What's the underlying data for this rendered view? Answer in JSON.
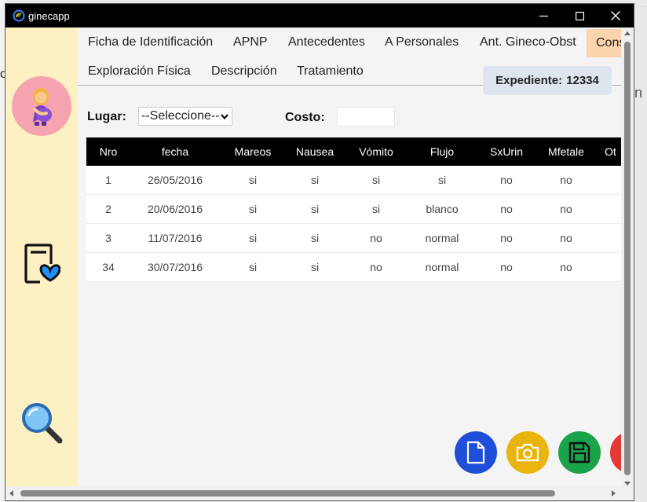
{
  "window": {
    "title": "ginecapp"
  },
  "tabs": {
    "row1": [
      "Ficha de Identificación",
      "APNP",
      "Antecedentes",
      "A Personales",
      "Ant. Gineco-Obst",
      "Cons"
    ],
    "row2": [
      "Exploración Física",
      "Descripción",
      "Tratamiento"
    ],
    "active": "Cons"
  },
  "expediente": {
    "label": "Expediente:",
    "value": "12334"
  },
  "form": {
    "lugar_label": "Lugar:",
    "lugar_selected": "--Seleccione--",
    "costo_label": "Costo:",
    "costo_value": ""
  },
  "table": {
    "columns": [
      "Nro",
      "fecha",
      "Mareos",
      "Nausea",
      "Vómito",
      "Flujo",
      "SxUrin",
      "Mfetale",
      "Ot"
    ],
    "rows": [
      [
        "1",
        "26/05/2016",
        "si",
        "si",
        "si",
        "si",
        "no",
        "no"
      ],
      [
        "2",
        "20/06/2016",
        "si",
        "si",
        "si",
        "blanco",
        "no",
        "no"
      ],
      [
        "3",
        "11/07/2016",
        "si",
        "si",
        "no",
        "normal",
        "no",
        "no"
      ],
      [
        "34",
        "30/07/2016",
        "si",
        "si",
        "no",
        "normal",
        "no",
        "no"
      ]
    ]
  },
  "sidebar": {
    "icons": [
      "pregnant-woman-icon",
      "medical-record-heart-icon",
      "search-icon"
    ]
  },
  "actions": {
    "icons": [
      "document-icon",
      "camera-icon",
      "save-icon",
      "delete-icon"
    ],
    "colors": {
      "document": "#1f4fd8",
      "camera": "#e9b40d",
      "save": "#1aa34a",
      "delete": "#e53935"
    }
  },
  "colors": {
    "titlebar": "#000000",
    "sidebar": "#fdf1c3",
    "active_tab": "#fbd3ad",
    "table_header": "#000000",
    "avatar_bg": "#f5a3ae"
  }
}
